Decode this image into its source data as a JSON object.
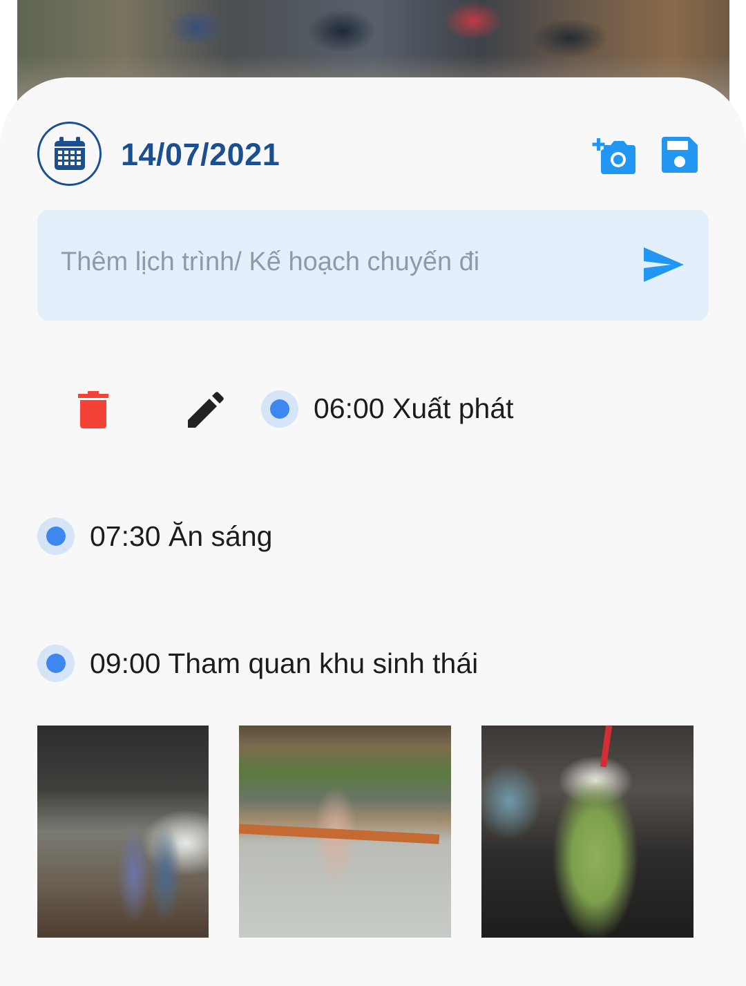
{
  "header": {
    "date": "14/07/2021"
  },
  "input": {
    "placeholder": "Thêm lịch trình/ Kế hoạch chuyến đi"
  },
  "schedule": {
    "items": [
      {
        "label": "06:00 Xuất phát"
      },
      {
        "label": "07:30 Ăn sáng"
      },
      {
        "label": "09:00 Tham quan khu sinh thái"
      }
    ]
  },
  "icons": {
    "calendar": "calendar-icon",
    "add_photo": "add-photo-icon",
    "save": "save-icon",
    "send": "send-icon",
    "delete": "trash-icon",
    "edit": "edit-icon"
  },
  "colors": {
    "primary_dark": "#1b4f8f",
    "accent_blue": "#2196f3",
    "delete_red": "#f44336",
    "input_bg": "#e3effb",
    "dot_blue": "#3d87ef"
  },
  "photos": [
    {
      "description_name": "photo-two-girls-cafe"
    },
    {
      "description_name": "photo-girl-on-swing"
    },
    {
      "description_name": "photo-green-drink"
    }
  ]
}
